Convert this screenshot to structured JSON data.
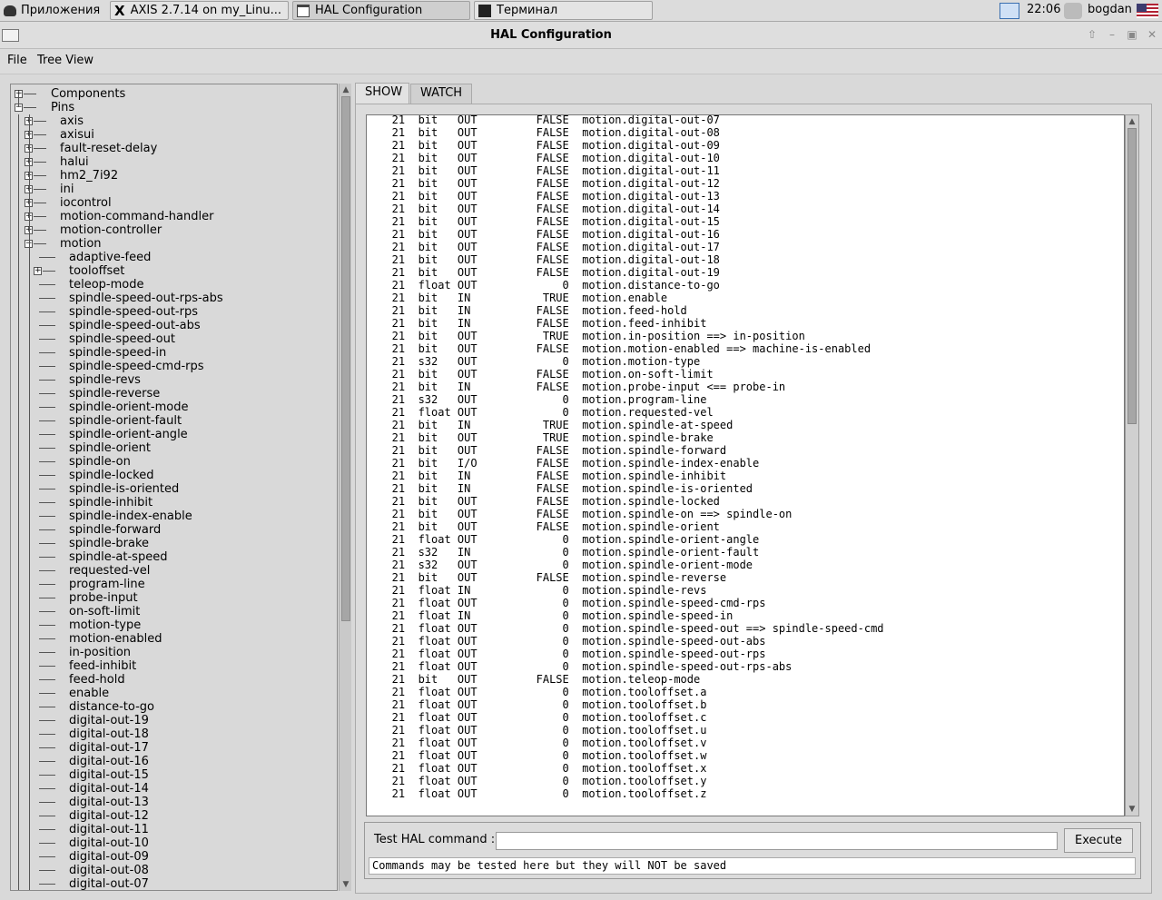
{
  "taskbar": {
    "apps_label": "Приложения",
    "tasks": [
      {
        "label": "AXIS 2.7.14 on my_Linu..."
      },
      {
        "label": "HAL Configuration"
      },
      {
        "label": "Терминал"
      }
    ],
    "clock": "22:06",
    "user": "bogdan"
  },
  "window": {
    "title": "HAL Configuration"
  },
  "menu": {
    "file": "File",
    "tree_view": "Tree View"
  },
  "tree": {
    "top": [
      {
        "label": "Components",
        "expanded": false
      },
      {
        "label": "Pins",
        "expanded": true
      }
    ],
    "pins_children": [
      {
        "label": "axis",
        "expanded": false
      },
      {
        "label": "axisui",
        "expanded": false
      },
      {
        "label": "fault-reset-delay",
        "expanded": false
      },
      {
        "label": "halui",
        "expanded": false
      },
      {
        "label": "hm2_7i92",
        "expanded": false
      },
      {
        "label": "ini",
        "expanded": false
      },
      {
        "label": "iocontrol",
        "expanded": false
      },
      {
        "label": "motion-command-handler",
        "expanded": false
      },
      {
        "label": "motion-controller",
        "expanded": false
      },
      {
        "label": "motion",
        "expanded": true
      }
    ],
    "motion_children": [
      {
        "label": "adaptive-feed",
        "has_children": false
      },
      {
        "label": "tooloffset",
        "has_children": true
      },
      {
        "label": "teleop-mode",
        "has_children": false
      },
      {
        "label": "spindle-speed-out-rps-abs",
        "has_children": false
      },
      {
        "label": "spindle-speed-out-rps",
        "has_children": false
      },
      {
        "label": "spindle-speed-out-abs",
        "has_children": false
      },
      {
        "label": "spindle-speed-out",
        "has_children": false
      },
      {
        "label": "spindle-speed-in",
        "has_children": false
      },
      {
        "label": "spindle-speed-cmd-rps",
        "has_children": false
      },
      {
        "label": "spindle-revs",
        "has_children": false
      },
      {
        "label": "spindle-reverse",
        "has_children": false
      },
      {
        "label": "spindle-orient-mode",
        "has_children": false
      },
      {
        "label": "spindle-orient-fault",
        "has_children": false
      },
      {
        "label": "spindle-orient-angle",
        "has_children": false
      },
      {
        "label": "spindle-orient",
        "has_children": false
      },
      {
        "label": "spindle-on",
        "has_children": false
      },
      {
        "label": "spindle-locked",
        "has_children": false
      },
      {
        "label": "spindle-is-oriented",
        "has_children": false
      },
      {
        "label": "spindle-inhibit",
        "has_children": false
      },
      {
        "label": "spindle-index-enable",
        "has_children": false
      },
      {
        "label": "spindle-forward",
        "has_children": false
      },
      {
        "label": "spindle-brake",
        "has_children": false
      },
      {
        "label": "spindle-at-speed",
        "has_children": false
      },
      {
        "label": "requested-vel",
        "has_children": false
      },
      {
        "label": "program-line",
        "has_children": false
      },
      {
        "label": "probe-input",
        "has_children": false
      },
      {
        "label": "on-soft-limit",
        "has_children": false
      },
      {
        "label": "motion-type",
        "has_children": false
      },
      {
        "label": "motion-enabled",
        "has_children": false
      },
      {
        "label": "in-position",
        "has_children": false
      },
      {
        "label": "feed-inhibit",
        "has_children": false
      },
      {
        "label": "feed-hold",
        "has_children": false
      },
      {
        "label": "enable",
        "has_children": false
      },
      {
        "label": "distance-to-go",
        "has_children": false
      },
      {
        "label": "digital-out-19",
        "has_children": false
      },
      {
        "label": "digital-out-18",
        "has_children": false
      },
      {
        "label": "digital-out-17",
        "has_children": false
      },
      {
        "label": "digital-out-16",
        "has_children": false
      },
      {
        "label": "digital-out-15",
        "has_children": false
      },
      {
        "label": "digital-out-14",
        "has_children": false
      },
      {
        "label": "digital-out-13",
        "has_children": false
      },
      {
        "label": "digital-out-12",
        "has_children": false
      },
      {
        "label": "digital-out-11",
        "has_children": false
      },
      {
        "label": "digital-out-10",
        "has_children": false
      },
      {
        "label": "digital-out-09",
        "has_children": false
      },
      {
        "label": "digital-out-08",
        "has_children": false
      },
      {
        "label": "digital-out-07",
        "has_children": false
      }
    ]
  },
  "tabs": [
    {
      "label": "SHOW",
      "selected": true
    },
    {
      "label": "WATCH",
      "selected": false
    }
  ],
  "pins": [
    {
      "comp": "21",
      "type": "bit",
      "dir": "OUT",
      "value": "FALSE",
      "name": "motion.digital-out-07"
    },
    {
      "comp": "21",
      "type": "bit",
      "dir": "OUT",
      "value": "FALSE",
      "name": "motion.digital-out-08"
    },
    {
      "comp": "21",
      "type": "bit",
      "dir": "OUT",
      "value": "FALSE",
      "name": "motion.digital-out-09"
    },
    {
      "comp": "21",
      "type": "bit",
      "dir": "OUT",
      "value": "FALSE",
      "name": "motion.digital-out-10"
    },
    {
      "comp": "21",
      "type": "bit",
      "dir": "OUT",
      "value": "FALSE",
      "name": "motion.digital-out-11"
    },
    {
      "comp": "21",
      "type": "bit",
      "dir": "OUT",
      "value": "FALSE",
      "name": "motion.digital-out-12"
    },
    {
      "comp": "21",
      "type": "bit",
      "dir": "OUT",
      "value": "FALSE",
      "name": "motion.digital-out-13"
    },
    {
      "comp": "21",
      "type": "bit",
      "dir": "OUT",
      "value": "FALSE",
      "name": "motion.digital-out-14"
    },
    {
      "comp": "21",
      "type": "bit",
      "dir": "OUT",
      "value": "FALSE",
      "name": "motion.digital-out-15"
    },
    {
      "comp": "21",
      "type": "bit",
      "dir": "OUT",
      "value": "FALSE",
      "name": "motion.digital-out-16"
    },
    {
      "comp": "21",
      "type": "bit",
      "dir": "OUT",
      "value": "FALSE",
      "name": "motion.digital-out-17"
    },
    {
      "comp": "21",
      "type": "bit",
      "dir": "OUT",
      "value": "FALSE",
      "name": "motion.digital-out-18"
    },
    {
      "comp": "21",
      "type": "bit",
      "dir": "OUT",
      "value": "FALSE",
      "name": "motion.digital-out-19"
    },
    {
      "comp": "21",
      "type": "float",
      "dir": "OUT",
      "value": "0",
      "name": "motion.distance-to-go"
    },
    {
      "comp": "21",
      "type": "bit",
      "dir": "IN",
      "value": "TRUE",
      "name": "motion.enable"
    },
    {
      "comp": "21",
      "type": "bit",
      "dir": "IN",
      "value": "FALSE",
      "name": "motion.feed-hold"
    },
    {
      "comp": "21",
      "type": "bit",
      "dir": "IN",
      "value": "FALSE",
      "name": "motion.feed-inhibit"
    },
    {
      "comp": "21",
      "type": "bit",
      "dir": "OUT",
      "value": "TRUE",
      "name": "motion.in-position ==> in-position"
    },
    {
      "comp": "21",
      "type": "bit",
      "dir": "OUT",
      "value": "FALSE",
      "name": "motion.motion-enabled ==> machine-is-enabled"
    },
    {
      "comp": "21",
      "type": "s32",
      "dir": "OUT",
      "value": "0",
      "name": "motion.motion-type"
    },
    {
      "comp": "21",
      "type": "bit",
      "dir": "OUT",
      "value": "FALSE",
      "name": "motion.on-soft-limit"
    },
    {
      "comp": "21",
      "type": "bit",
      "dir": "IN",
      "value": "FALSE",
      "name": "motion.probe-input <== probe-in"
    },
    {
      "comp": "21",
      "type": "s32",
      "dir": "OUT",
      "value": "0",
      "name": "motion.program-line"
    },
    {
      "comp": "21",
      "type": "float",
      "dir": "OUT",
      "value": "0",
      "name": "motion.requested-vel"
    },
    {
      "comp": "21",
      "type": "bit",
      "dir": "IN",
      "value": "TRUE",
      "name": "motion.spindle-at-speed"
    },
    {
      "comp": "21",
      "type": "bit",
      "dir": "OUT",
      "value": "TRUE",
      "name": "motion.spindle-brake"
    },
    {
      "comp": "21",
      "type": "bit",
      "dir": "OUT",
      "value": "FALSE",
      "name": "motion.spindle-forward"
    },
    {
      "comp": "21",
      "type": "bit",
      "dir": "I/O",
      "value": "FALSE",
      "name": "motion.spindle-index-enable"
    },
    {
      "comp": "21",
      "type": "bit",
      "dir": "IN",
      "value": "FALSE",
      "name": "motion.spindle-inhibit"
    },
    {
      "comp": "21",
      "type": "bit",
      "dir": "IN",
      "value": "FALSE",
      "name": "motion.spindle-is-oriented"
    },
    {
      "comp": "21",
      "type": "bit",
      "dir": "OUT",
      "value": "FALSE",
      "name": "motion.spindle-locked"
    },
    {
      "comp": "21",
      "type": "bit",
      "dir": "OUT",
      "value": "FALSE",
      "name": "motion.spindle-on ==> spindle-on"
    },
    {
      "comp": "21",
      "type": "bit",
      "dir": "OUT",
      "value": "FALSE",
      "name": "motion.spindle-orient"
    },
    {
      "comp": "21",
      "type": "float",
      "dir": "OUT",
      "value": "0",
      "name": "motion.spindle-orient-angle"
    },
    {
      "comp": "21",
      "type": "s32",
      "dir": "IN",
      "value": "0",
      "name": "motion.spindle-orient-fault"
    },
    {
      "comp": "21",
      "type": "s32",
      "dir": "OUT",
      "value": "0",
      "name": "motion.spindle-orient-mode"
    },
    {
      "comp": "21",
      "type": "bit",
      "dir": "OUT",
      "value": "FALSE",
      "name": "motion.spindle-reverse"
    },
    {
      "comp": "21",
      "type": "float",
      "dir": "IN",
      "value": "0",
      "name": "motion.spindle-revs"
    },
    {
      "comp": "21",
      "type": "float",
      "dir": "OUT",
      "value": "0",
      "name": "motion.spindle-speed-cmd-rps"
    },
    {
      "comp": "21",
      "type": "float",
      "dir": "IN",
      "value": "0",
      "name": "motion.spindle-speed-in"
    },
    {
      "comp": "21",
      "type": "float",
      "dir": "OUT",
      "value": "0",
      "name": "motion.spindle-speed-out ==> spindle-speed-cmd"
    },
    {
      "comp": "21",
      "type": "float",
      "dir": "OUT",
      "value": "0",
      "name": "motion.spindle-speed-out-abs"
    },
    {
      "comp": "21",
      "type": "float",
      "dir": "OUT",
      "value": "0",
      "name": "motion.spindle-speed-out-rps"
    },
    {
      "comp": "21",
      "type": "float",
      "dir": "OUT",
      "value": "0",
      "name": "motion.spindle-speed-out-rps-abs"
    },
    {
      "comp": "21",
      "type": "bit",
      "dir": "OUT",
      "value": "FALSE",
      "name": "motion.teleop-mode"
    },
    {
      "comp": "21",
      "type": "float",
      "dir": "OUT",
      "value": "0",
      "name": "motion.tooloffset.a"
    },
    {
      "comp": "21",
      "type": "float",
      "dir": "OUT",
      "value": "0",
      "name": "motion.tooloffset.b"
    },
    {
      "comp": "21",
      "type": "float",
      "dir": "OUT",
      "value": "0",
      "name": "motion.tooloffset.c"
    },
    {
      "comp": "21",
      "type": "float",
      "dir": "OUT",
      "value": "0",
      "name": "motion.tooloffset.u"
    },
    {
      "comp": "21",
      "type": "float",
      "dir": "OUT",
      "value": "0",
      "name": "motion.tooloffset.v"
    },
    {
      "comp": "21",
      "type": "float",
      "dir": "OUT",
      "value": "0",
      "name": "motion.tooloffset.w"
    },
    {
      "comp": "21",
      "type": "float",
      "dir": "OUT",
      "value": "0",
      "name": "motion.tooloffset.x"
    },
    {
      "comp": "21",
      "type": "float",
      "dir": "OUT",
      "value": "0",
      "name": "motion.tooloffset.y"
    },
    {
      "comp": "21",
      "type": "float",
      "dir": "OUT",
      "value": "0",
      "name": "motion.tooloffset.z"
    }
  ],
  "command": {
    "label": "Test HAL command :",
    "value": "",
    "execute_label": "Execute",
    "note": "Commands may be tested here but they will NOT be saved"
  },
  "icons": {
    "apps": "mouse-logo-icon",
    "axis_task": "x-logo-icon",
    "hal_task": "window-icon",
    "terminal_task": "terminal-icon",
    "tray": "window-icon",
    "network": "network-icon",
    "flag": "us-flag-icon"
  }
}
